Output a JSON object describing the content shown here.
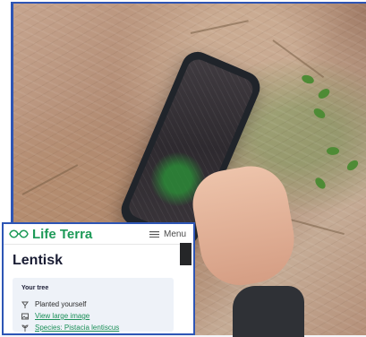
{
  "app": {
    "brand_name": "Life Terra",
    "menu_label": "Menu",
    "page_title": "Lentisk"
  },
  "tree_panel": {
    "heading": "Your tree",
    "items": [
      {
        "label": "Planted yourself",
        "icon": "tree-icon"
      },
      {
        "label": "View large image",
        "icon": "image-icon"
      },
      {
        "label": "Species: Pistacia lentiscus",
        "icon": "plant-icon"
      }
    ]
  },
  "colors": {
    "brand_green": "#1d9a58",
    "title_navy": "#191c33",
    "border_blue": "#2d55b5",
    "panel_bg": "#eef2f8"
  }
}
